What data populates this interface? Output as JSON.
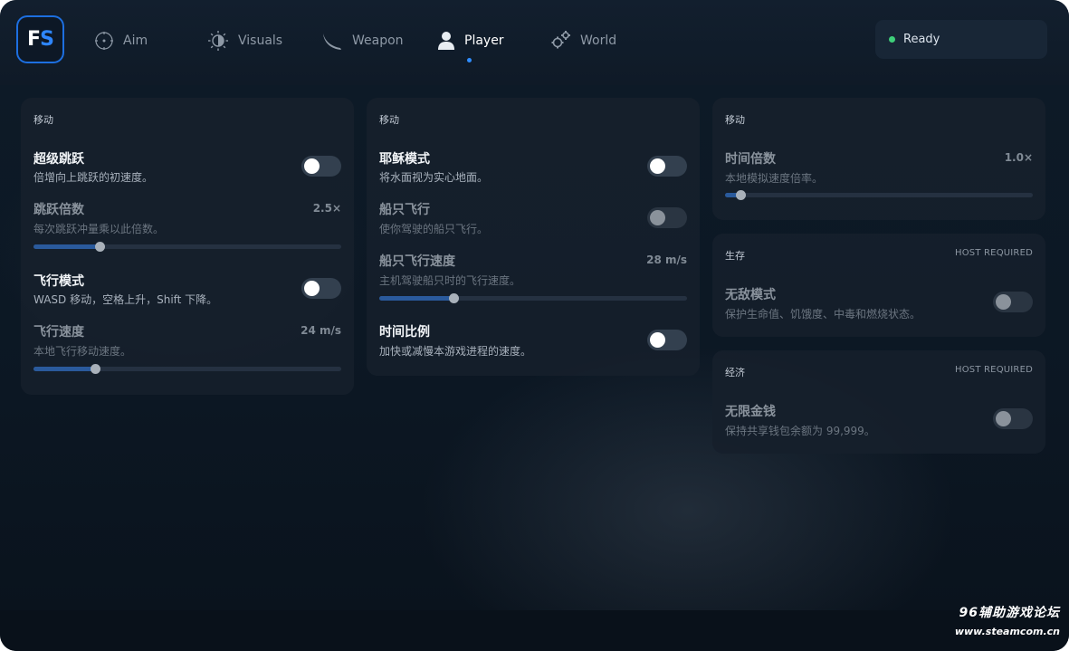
{
  "logo": {
    "f": "F",
    "s": "S"
  },
  "tabs": [
    {
      "label": "Aim",
      "icon": "crosshair-icon",
      "active": false
    },
    {
      "label": "Visuals",
      "icon": "sun-icon",
      "active": false
    },
    {
      "label": "Weapon",
      "icon": "blade-icon",
      "active": false
    },
    {
      "label": "Player",
      "icon": "user-icon",
      "active": true
    },
    {
      "label": "World",
      "icon": "gears-icon",
      "active": false
    }
  ],
  "status": {
    "text": "Ready",
    "color": "#3ecf7a"
  },
  "card1": {
    "title": "移动",
    "jump": {
      "label": "超级跳跃",
      "desc": "倍增向上跳跃的初速度。",
      "on": false
    },
    "jump_mult": {
      "label": "跳跃倍数",
      "desc": "每次跳跃冲量乘以此倍数。",
      "value": "2.5×",
      "level": 0.215
    },
    "fly": {
      "label": "飞行模式",
      "desc": "WASD 移动，空格上升，Shift 下降。",
      "on": false
    },
    "fly_speed": {
      "label": "飞行速度",
      "desc": "本地飞行移动速度。",
      "value": "24 m/s",
      "level": 0.2
    }
  },
  "card2": {
    "title": "移动",
    "jesus": {
      "label": "耶稣模式",
      "desc": "将水面视为实心地面。",
      "on": false
    },
    "boat_fly": {
      "label": "船只飞行",
      "desc": "使你驾驶的船只飞行。",
      "on": false,
      "disabled": true
    },
    "boat_speed": {
      "label": "船只飞行速度",
      "desc": "主机驾驶船只时的飞行速度。",
      "value": "28 m/s",
      "level": 0.24
    },
    "timescale": {
      "label": "时间比例",
      "desc": "加快或减慢本游戏进程的速度。",
      "on": false
    }
  },
  "card3": {
    "title": "移动",
    "time_mult": {
      "label": "时间倍数",
      "desc": "本地模拟速度倍率。",
      "value": "1.0×",
      "level": 0.05
    }
  },
  "card4": {
    "title": "生存",
    "badge": "HOST REQUIRED",
    "god": {
      "label": "无敌模式",
      "desc": "保护生命值、饥饿度、中毒和燃烧状态。",
      "on": false,
      "disabled": true
    }
  },
  "card5": {
    "title": "经济",
    "badge": "HOST REQUIRED",
    "money": {
      "label": "无限金钱",
      "desc": "保持共享钱包余额为 99,999。",
      "on": false,
      "disabled": true
    }
  },
  "watermark": {
    "line1": "96辅助游戏论坛",
    "line2": "www.steamcom.cn"
  }
}
